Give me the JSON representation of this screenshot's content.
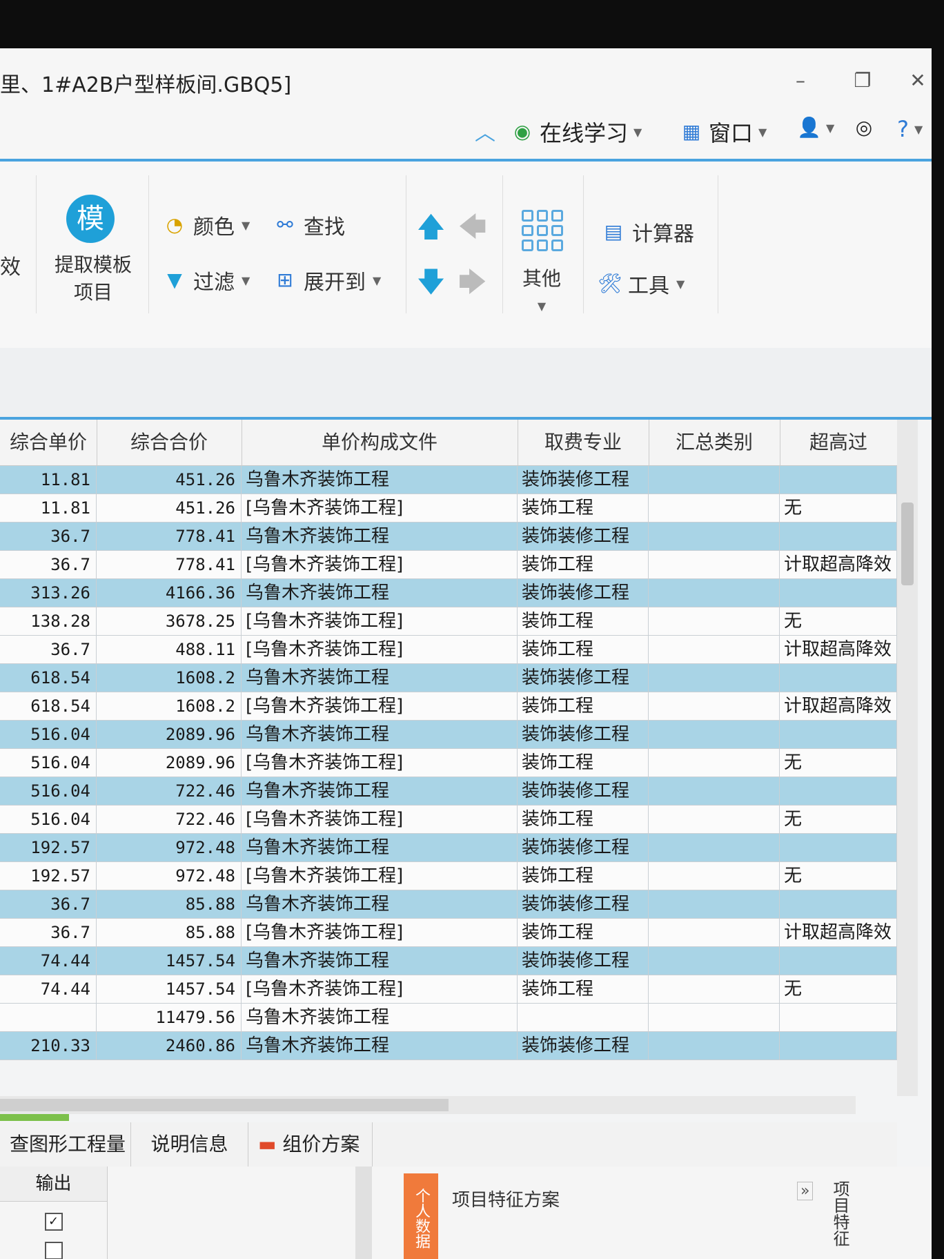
{
  "window": {
    "title": "里、1#A2B户型样板间.GBQ5]",
    "minimize": "–",
    "restore": "❐",
    "close": "✕"
  },
  "toprow": {
    "online_learning": "在线学习",
    "window_menu": "窗口"
  },
  "ribbon": {
    "left_partial": "效",
    "extract_template_icon": "模",
    "extract_template_line1": "提取模板",
    "extract_template_line2": "项目",
    "color": "颜色",
    "find": "查找",
    "filter": "过滤",
    "expand_to": "展开到",
    "other": "其他",
    "calculator": "计算器",
    "tools": "工具"
  },
  "table": {
    "headers": [
      "综合单价",
      "综合合价",
      "单价构成文件",
      "取费专业",
      "汇总类别",
      "超高过"
    ],
    "rows": [
      {
        "style": "blue",
        "unit": "11.81",
        "total": "451.26",
        "file": "乌鲁木齐装饰工程",
        "fee": "装饰装修工程",
        "cat": "",
        "over": ""
      },
      {
        "style": "white",
        "unit": "11.81",
        "total": "451.26",
        "file": "[乌鲁木齐装饰工程]",
        "fee": "装饰工程",
        "cat": "",
        "over": "无"
      },
      {
        "style": "blue",
        "unit": "36.7",
        "total": "778.41",
        "file": "乌鲁木齐装饰工程",
        "fee": "装饰装修工程",
        "cat": "",
        "over": ""
      },
      {
        "style": "white",
        "unit": "36.7",
        "total": "778.41",
        "file": "[乌鲁木齐装饰工程]",
        "fee": "装饰工程",
        "cat": "",
        "over": "计取超高降效"
      },
      {
        "style": "blue",
        "unit": "313.26",
        "total": "4166.36",
        "file": "乌鲁木齐装饰工程",
        "fee": "装饰装修工程",
        "cat": "",
        "over": ""
      },
      {
        "style": "white",
        "unit": "138.28",
        "total": "3678.25",
        "file": "[乌鲁木齐装饰工程]",
        "fee": "装饰工程",
        "cat": "",
        "over": "无"
      },
      {
        "style": "white",
        "unit": "36.7",
        "total": "488.11",
        "file": "[乌鲁木齐装饰工程]",
        "fee": "装饰工程",
        "cat": "",
        "over": "计取超高降效"
      },
      {
        "style": "blue",
        "unit": "618.54",
        "total": "1608.2",
        "file": "乌鲁木齐装饰工程",
        "fee": "装饰装修工程",
        "cat": "",
        "over": ""
      },
      {
        "style": "white",
        "unit": "618.54",
        "total": "1608.2",
        "file": "[乌鲁木齐装饰工程]",
        "fee": "装饰工程",
        "cat": "",
        "over": "计取超高降效"
      },
      {
        "style": "blue",
        "unit": "516.04",
        "total": "2089.96",
        "file": "乌鲁木齐装饰工程",
        "fee": "装饰装修工程",
        "cat": "",
        "over": ""
      },
      {
        "style": "white",
        "unit": "516.04",
        "total": "2089.96",
        "file": "[乌鲁木齐装饰工程]",
        "fee": "装饰工程",
        "cat": "",
        "over": "无"
      },
      {
        "style": "blue",
        "unit": "516.04",
        "total": "722.46",
        "file": "乌鲁木齐装饰工程",
        "fee": "装饰装修工程",
        "cat": "",
        "over": ""
      },
      {
        "style": "white",
        "unit": "516.04",
        "total": "722.46",
        "file": "[乌鲁木齐装饰工程]",
        "fee": "装饰工程",
        "cat": "",
        "over": "无"
      },
      {
        "style": "blue",
        "unit": "192.57",
        "total": "972.48",
        "file": "乌鲁木齐装饰工程",
        "fee": "装饰装修工程",
        "cat": "",
        "over": ""
      },
      {
        "style": "white",
        "unit": "192.57",
        "total": "972.48",
        "file": "[乌鲁木齐装饰工程]",
        "fee": "装饰工程",
        "cat": "",
        "over": "无"
      },
      {
        "style": "blue",
        "unit": "36.7",
        "total": "85.88",
        "file": "乌鲁木齐装饰工程",
        "fee": "装饰装修工程",
        "cat": "",
        "over": ""
      },
      {
        "style": "white",
        "unit": "36.7",
        "total": "85.88",
        "file": "[乌鲁木齐装饰工程]",
        "fee": "装饰工程",
        "cat": "",
        "over": "计取超高降效"
      },
      {
        "style": "blue",
        "unit": "74.44",
        "total": "1457.54",
        "file": "乌鲁木齐装饰工程",
        "fee": "装饰装修工程",
        "cat": "",
        "over": ""
      },
      {
        "style": "white",
        "unit": "74.44",
        "total": "1457.54",
        "file": "[乌鲁木齐装饰工程]",
        "fee": "装饰工程",
        "cat": "",
        "over": "无"
      },
      {
        "style": "white",
        "unit": "",
        "total": "11479.56",
        "file": "乌鲁木齐装饰工程",
        "fee": "",
        "cat": "",
        "over": ""
      },
      {
        "style": "blue",
        "unit": "210.33",
        "total": "2460.86",
        "file": "乌鲁木齐装饰工程",
        "fee": "装饰装修工程",
        "cat": "",
        "over": ""
      }
    ]
  },
  "bottom_tabs": {
    "graphic_qty": "查图形工程量",
    "description": "说明信息",
    "pricing_scheme": "组价方案"
  },
  "bottom_panel": {
    "output_header": "输出",
    "personal_data": "个人数据",
    "feature_scheme": "项目特征方案",
    "right_vertical": "项目特征"
  }
}
